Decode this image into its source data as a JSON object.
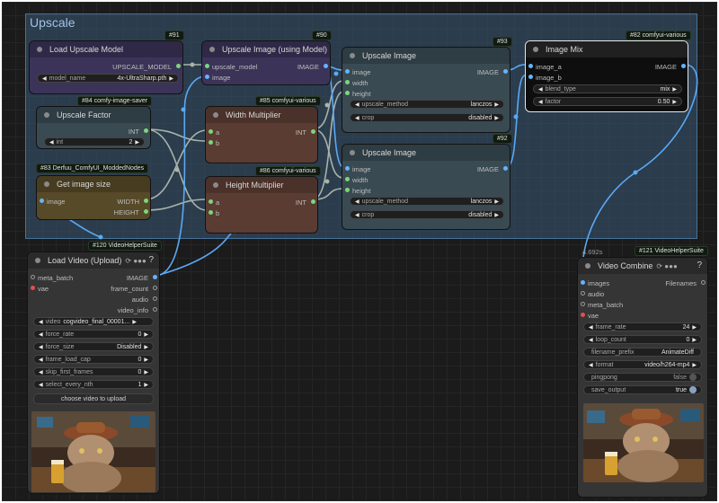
{
  "group": {
    "title": "Upscale"
  },
  "nodes": {
    "load_upscale": {
      "badge": "#91",
      "title": "Load Upscale Model",
      "out": "UPSCALE_MODEL",
      "model_label": "model_name",
      "model_value": "4x-UltraSharp.pth"
    },
    "upscale_model": {
      "badge": "#90",
      "title": "Upscale Image (using Model)",
      "in1": "upscale_model",
      "in2": "image",
      "out": "IMAGE"
    },
    "upscale_93": {
      "badge": "#93",
      "title": "Upscale Image",
      "in1": "image",
      "in2": "width",
      "in3": "height",
      "out": "IMAGE",
      "method_label": "upscale_method",
      "method_value": "lanczos",
      "crop_label": "crop",
      "crop_value": "disabled"
    },
    "image_mix": {
      "badge": "#82 comfyui-various",
      "title": "Image Mix",
      "in1": "image_a",
      "in2": "image_b",
      "out": "IMAGE",
      "blend_label": "blend_type",
      "blend_value": "mix",
      "factor_label": "factor",
      "factor_value": "0.50"
    },
    "upscale_factor": {
      "badge": "#84 comfy-image-saver",
      "title": "Upscale Factor",
      "out": "INT",
      "int_label": "int",
      "int_value": "2"
    },
    "width_mult": {
      "badge": "#85 comfyui-various",
      "title": "Width Multiplier",
      "in1": "a",
      "in2": "b",
      "out": "INT"
    },
    "upscale_92": {
      "badge": "#92",
      "title": "Upscale Image",
      "in1": "image",
      "in2": "width",
      "in3": "height",
      "out": "IMAGE",
      "method_label": "upscale_method",
      "method_value": "lanczos",
      "crop_label": "crop",
      "crop_value": "disabled"
    },
    "get_size": {
      "badge": "#83 Derfuu_ComfyUI_ModdedNodes",
      "title": "Get image size",
      "in1": "image",
      "out1": "WIDTH",
      "out2": "HEIGHT"
    },
    "height_mult": {
      "badge": "#86 comfyui-various",
      "title": "Height Multiplier",
      "in1": "a",
      "in2": "b",
      "out": "INT"
    },
    "load_video": {
      "badge": "#120 VideoHelperSuite",
      "title": "Load Video (Upload)",
      "icons": "⟳ ●●●",
      "help": "?",
      "in1": "meta_batch",
      "in2": "vae",
      "out1": "IMAGE",
      "out2": "frame_count",
      "out3": "audio",
      "out4": "video_info",
      "widgets": [
        {
          "label": "video",
          "value": "cogvideo_final_00001..."
        },
        {
          "label": "force_rate",
          "value": "0"
        },
        {
          "label": "force_size",
          "value": "Disabled"
        },
        {
          "label": "frame_load_cap",
          "value": "0"
        },
        {
          "label": "skip_first_frames",
          "value": "0"
        },
        {
          "label": "select_every_nth",
          "value": "1"
        }
      ],
      "upload": "choose video to upload"
    },
    "video_combine": {
      "badge": "#121 VideoHelperSuite",
      "timing": "4.692s",
      "title": "Video Combine",
      "icons": "⟳ ●●●",
      "help": "?",
      "in1": "images",
      "in2": "audio",
      "in3": "meta_batch",
      "in4": "vae",
      "out": "Filenames",
      "widgets": [
        {
          "label": "frame_rate",
          "value": "24"
        },
        {
          "label": "loop_count",
          "value": "0"
        },
        {
          "label": "filename_prefix",
          "value": "AnimateDiff"
        },
        {
          "label": "format",
          "value": "video/h264-mp4"
        },
        {
          "label": "pingpong",
          "value": "false"
        },
        {
          "label": "save_output",
          "value": "true"
        }
      ]
    }
  },
  "colors": {
    "input_pin": "#64b4ff",
    "link": "#5aa9f5",
    "green_pin": "#7cd67c",
    "vae_pin": "#e05050"
  }
}
